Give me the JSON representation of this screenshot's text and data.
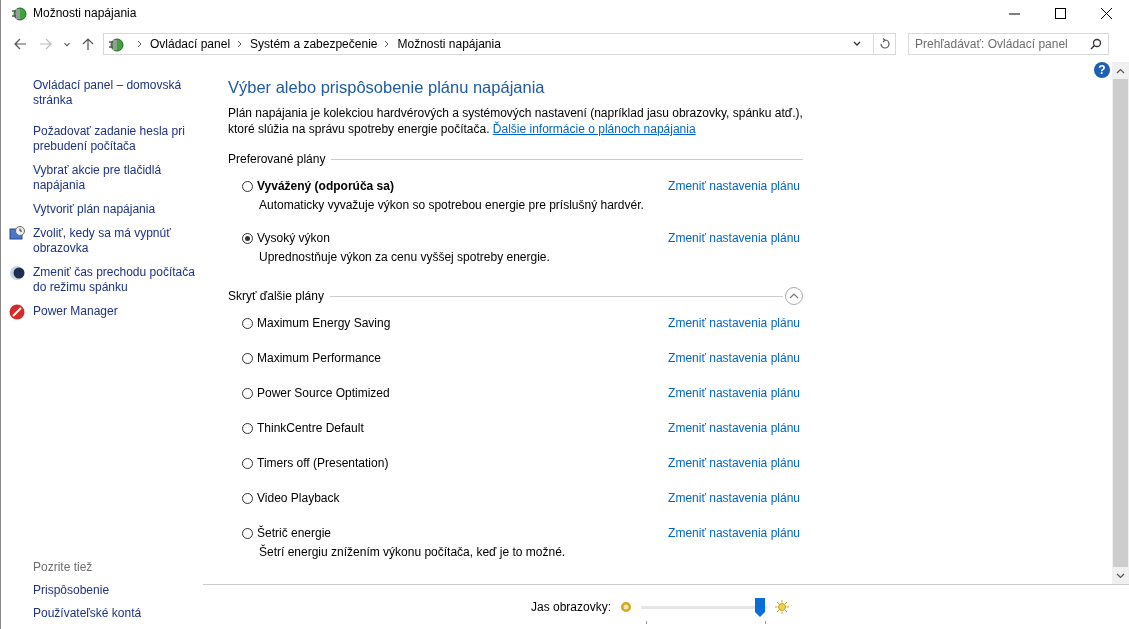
{
  "window": {
    "title": "Možnosti napájania"
  },
  "address_bar": {
    "breadcrumbs": [
      "Ovládací panel",
      "Systém a zabezpečenie",
      "Možnosti napájania"
    ]
  },
  "search": {
    "placeholder": "Prehľadávať: Ovládací panel"
  },
  "sidebar": {
    "items": [
      {
        "label": "Ovládací panel – domovská stránka",
        "kind": "home"
      },
      {
        "label": "Požadovať zadanie hesla pri prebudení počítača",
        "kind": "link"
      },
      {
        "label": "Vybrať akcie pre tlačidlá napájania",
        "kind": "link"
      },
      {
        "label": "Vytvoriť plán napájania",
        "kind": "link"
      },
      {
        "label": "Zvoliť, kedy sa má vypnúť obrazovka",
        "kind": "monitor"
      },
      {
        "label": "Zmeniť čas prechodu počítača do režimu spánku",
        "kind": "moon"
      },
      {
        "label": "Power Manager",
        "kind": "power"
      }
    ],
    "see_also": {
      "heading": "Pozrite tiež",
      "items": [
        "Prispôsobenie",
        "Používateľské kontá"
      ]
    }
  },
  "main": {
    "help_button": "?",
    "heading": "Výber alebo prispôsobenie plánu napájania",
    "intro": "Plán napájania je kolekciou hardvérových a systémových nastavení (napríklad jasu obrazovky, spánku atď.), ktoré slúžia na správu spotreby energie počítača.",
    "intro_link": "Ďalšie informácie o plánoch napájania",
    "sections": [
      {
        "title": "Preferované plány",
        "plans": [
          {
            "name": "Vyvážený (odporúča sa)",
            "bold": true,
            "selected": false,
            "description": "Automaticky vyvažuje výkon so spotrebou energie pre príslušný hardvér.",
            "link": "Zmeniť nastavenia plánu"
          },
          {
            "name": "Vysoký výkon",
            "bold": false,
            "selected": true,
            "description": "Uprednostňuje výkon za cenu vyššej spotreby energie.",
            "link": "Zmeniť nastavenia plánu"
          }
        ]
      },
      {
        "title": "Skryť ďalšie plány",
        "expanded": true,
        "plans": [
          {
            "name": "Maximum Energy Saving",
            "bold": false,
            "selected": false,
            "link": "Zmeniť nastavenia plánu"
          },
          {
            "name": "Maximum Performance",
            "bold": false,
            "selected": false,
            "link": "Zmeniť nastavenia plánu"
          },
          {
            "name": "Power Source Optimized",
            "bold": false,
            "selected": false,
            "link": "Zmeniť nastavenia plánu"
          },
          {
            "name": "ThinkCentre Default",
            "bold": false,
            "selected": false,
            "link": "Zmeniť nastavenia plánu"
          },
          {
            "name": "Timers off (Presentation)",
            "bold": false,
            "selected": false,
            "link": "Zmeniť nastavenia plánu"
          },
          {
            "name": "Video Playback",
            "bold": false,
            "selected": false,
            "link": "Zmeniť nastavenia plánu"
          },
          {
            "name": "Šetrič energie",
            "bold": false,
            "selected": false,
            "description": "Šetrí energiu znížením výkonu počítača, keď je to možné.",
            "link": "Zmeniť nastavenia plánu"
          }
        ]
      }
    ]
  },
  "brightness": {
    "label": "Jas obrazovky:",
    "level": 0.98
  }
}
